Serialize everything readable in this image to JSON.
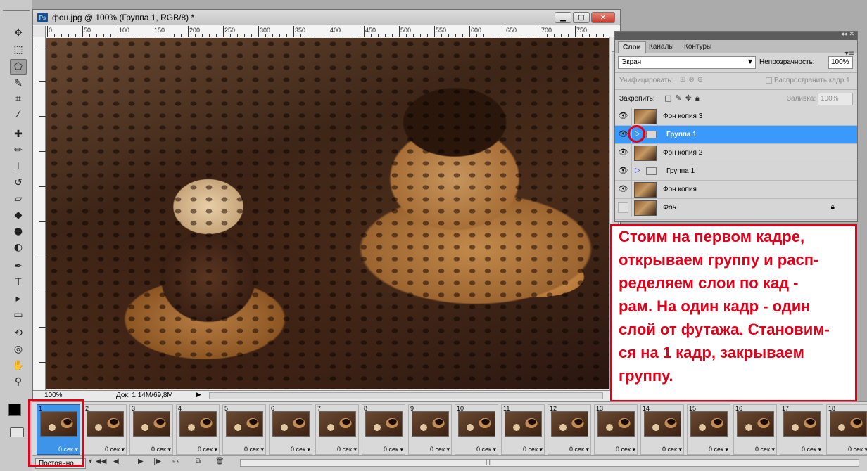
{
  "document": {
    "title": "фон.jpg @ 100% (Группа 1, RGB/8) *",
    "app_badge": "Ps",
    "ruler_labels": [
      "0",
      "50",
      "100",
      "150",
      "200",
      "250",
      "300",
      "350",
      "400",
      "450",
      "500",
      "550",
      "600",
      "650",
      "700",
      "750"
    ],
    "status": {
      "zoom": "100%",
      "doc_info": "Док: 1,14M/69,8M"
    }
  },
  "layers_panel": {
    "tabs": [
      "Слои",
      "Каналы",
      "Контуры"
    ],
    "blend_mode": "Экран",
    "opacity_label": "Непрозрачность:",
    "opacity_value": "100%",
    "unify_label": "Унифицировать:",
    "propagate_label": "Распространить кадр 1",
    "lock_label": "Закрепить:",
    "fill_label": "Заливка:",
    "fill_value": "100%",
    "layers": [
      {
        "name": "Фон копия 3",
        "type": "layer",
        "visible": true
      },
      {
        "name": "Группа 1",
        "type": "group",
        "visible": true,
        "selected": true
      },
      {
        "name": "Фон копия 2",
        "type": "layer",
        "visible": true
      },
      {
        "name": "Группа 1",
        "type": "group",
        "visible": true
      },
      {
        "name": "Фон копия",
        "type": "layer",
        "visible": true
      },
      {
        "name": "Фон",
        "type": "background",
        "visible": false,
        "locked": true
      }
    ]
  },
  "annotation": {
    "lines": [
      "Стоим на первом кадре,",
      "открываем группу и расп-",
      "ределяем слои по кад -",
      "рам. На один кадр - один",
      "слой от футажа. Становим-",
      "ся на 1 кадр, закрываем",
      "группу."
    ],
    "color": "#e0001a"
  },
  "animation": {
    "frames": [
      {
        "num": "1",
        "delay": "0 сек."
      },
      {
        "num": "2",
        "delay": "0 сек."
      },
      {
        "num": "3",
        "delay": "0 сек."
      },
      {
        "num": "4",
        "delay": "0 сек."
      },
      {
        "num": "5",
        "delay": "0 сек."
      },
      {
        "num": "6",
        "delay": "0 сек."
      },
      {
        "num": "7",
        "delay": "0 сек."
      },
      {
        "num": "8",
        "delay": "0 сек."
      },
      {
        "num": "9",
        "delay": "0 сек."
      },
      {
        "num": "10",
        "delay": "0 сек."
      },
      {
        "num": "11",
        "delay": "0 сек."
      },
      {
        "num": "12",
        "delay": "0 сек."
      },
      {
        "num": "13",
        "delay": "0 сек."
      },
      {
        "num": "14",
        "delay": "0 сек."
      },
      {
        "num": "15",
        "delay": "0 сек."
      },
      {
        "num": "16",
        "delay": "0 сек."
      },
      {
        "num": "17",
        "delay": "0 сек."
      },
      {
        "num": "18",
        "delay": "0 сек."
      }
    ],
    "loop": "Постоянно"
  },
  "colors": {
    "selection": "#3b99fc",
    "annotation_red": "#e0001a"
  }
}
